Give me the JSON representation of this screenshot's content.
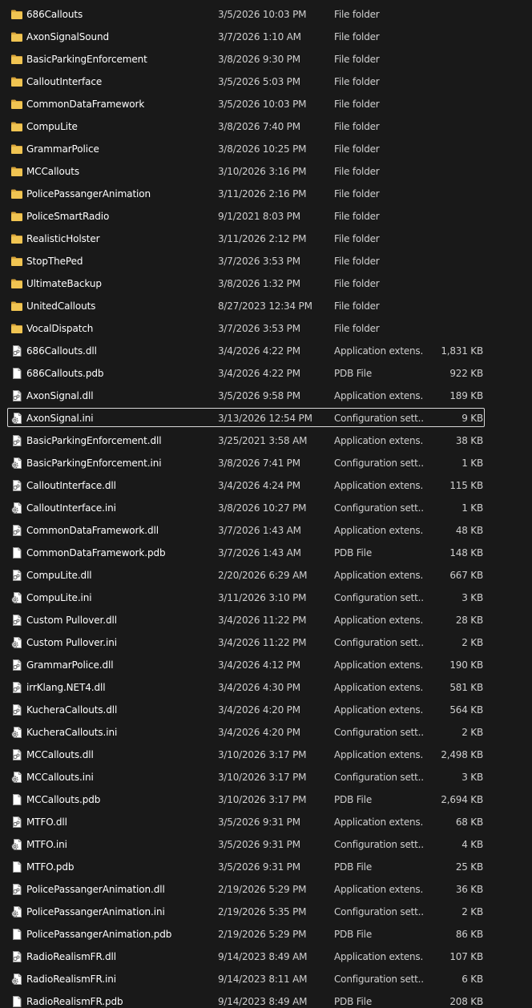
{
  "files": [
    {
      "name": "686Callouts",
      "date": "3/5/2026 10:03 PM",
      "type": "File folder",
      "size": "",
      "icon": "folder-icon"
    },
    {
      "name": "AxonSignalSound",
      "date": "3/7/2026 1:10 AM",
      "type": "File folder",
      "size": "",
      "icon": "folder-icon"
    },
    {
      "name": "BasicParkingEnforcement",
      "date": "3/8/2026 9:30 PM",
      "type": "File folder",
      "size": "",
      "icon": "folder-icon"
    },
    {
      "name": "CalloutInterface",
      "date": "3/5/2026 5:03 PM",
      "type": "File folder",
      "size": "",
      "icon": "folder-icon"
    },
    {
      "name": "CommonDataFramework",
      "date": "3/5/2026 10:03 PM",
      "type": "File folder",
      "size": "",
      "icon": "folder-icon"
    },
    {
      "name": "CompuLite",
      "date": "3/8/2026 7:40 PM",
      "type": "File folder",
      "size": "",
      "icon": "folder-icon"
    },
    {
      "name": "GrammarPolice",
      "date": "3/8/2026 10:25 PM",
      "type": "File folder",
      "size": "",
      "icon": "folder-icon"
    },
    {
      "name": "MCCallouts",
      "date": "3/10/2026 3:16 PM",
      "type": "File folder",
      "size": "",
      "icon": "folder-icon"
    },
    {
      "name": "PolicePassangerAnimation",
      "date": "3/11/2026 2:16 PM",
      "type": "File folder",
      "size": "",
      "icon": "folder-icon"
    },
    {
      "name": "PoliceSmartRadio",
      "date": "9/1/2021 8:03 PM",
      "type": "File folder",
      "size": "",
      "icon": "folder-icon"
    },
    {
      "name": "RealisticHolster",
      "date": "3/11/2026 2:12 PM",
      "type": "File folder",
      "size": "",
      "icon": "folder-icon"
    },
    {
      "name": "StopThePed",
      "date": "3/7/2026 3:53 PM",
      "type": "File folder",
      "size": "",
      "icon": "folder-icon"
    },
    {
      "name": "UltimateBackup",
      "date": "3/8/2026 1:32 PM",
      "type": "File folder",
      "size": "",
      "icon": "folder-icon"
    },
    {
      "name": "UnitedCallouts",
      "date": "8/27/2023 12:34 PM",
      "type": "File folder",
      "size": "",
      "icon": "folder-icon"
    },
    {
      "name": "VocalDispatch",
      "date": "3/7/2026 3:53 PM",
      "type": "File folder",
      "size": "",
      "icon": "folder-icon"
    },
    {
      "name": "686Callouts.dll",
      "date": "3/4/2026 4:22 PM",
      "type": "Application extens...",
      "size": "1,831 KB",
      "icon": "dll-file-icon"
    },
    {
      "name": "686Callouts.pdb",
      "date": "3/4/2026 4:22 PM",
      "type": "PDB File",
      "size": "922 KB",
      "icon": "blank-file-icon"
    },
    {
      "name": "AxonSignal.dll",
      "date": "3/5/2026 9:58 PM",
      "type": "Application extens...",
      "size": "189 KB",
      "icon": "dll-file-icon"
    },
    {
      "name": "AxonSignal.ini",
      "date": "3/13/2026 12:54 PM",
      "type": "Configuration sett...",
      "size": "9 KB",
      "icon": "config-file-icon",
      "selected": true
    },
    {
      "name": "BasicParkingEnforcement.dll",
      "date": "3/25/2021 3:58 AM",
      "type": "Application extens...",
      "size": "38 KB",
      "icon": "dll-file-icon"
    },
    {
      "name": "BasicParkingEnforcement.ini",
      "date": "3/8/2026 7:41 PM",
      "type": "Configuration sett...",
      "size": "1 KB",
      "icon": "config-file-icon"
    },
    {
      "name": "CalloutInterface.dll",
      "date": "3/4/2026 4:24 PM",
      "type": "Application extens...",
      "size": "115 KB",
      "icon": "dll-file-icon"
    },
    {
      "name": "CalloutInterface.ini",
      "date": "3/8/2026 10:27 PM",
      "type": "Configuration sett...",
      "size": "1 KB",
      "icon": "config-file-icon"
    },
    {
      "name": "CommonDataFramework.dll",
      "date": "3/7/2026 1:43 AM",
      "type": "Application extens...",
      "size": "48 KB",
      "icon": "dll-file-icon"
    },
    {
      "name": "CommonDataFramework.pdb",
      "date": "3/7/2026 1:43 AM",
      "type": "PDB File",
      "size": "148 KB",
      "icon": "blank-file-icon"
    },
    {
      "name": "CompuLite.dll",
      "date": "2/20/2026 6:29 AM",
      "type": "Application extens...",
      "size": "667 KB",
      "icon": "dll-file-icon"
    },
    {
      "name": "CompuLite.ini",
      "date": "3/11/2026 3:10 PM",
      "type": "Configuration sett...",
      "size": "3 KB",
      "icon": "config-file-icon"
    },
    {
      "name": "Custom Pullover.dll",
      "date": "3/4/2026 11:22 PM",
      "type": "Application extens...",
      "size": "28 KB",
      "icon": "dll-file-icon"
    },
    {
      "name": "Custom Pullover.ini",
      "date": "3/4/2026 11:22 PM",
      "type": "Configuration sett...",
      "size": "2 KB",
      "icon": "config-file-icon"
    },
    {
      "name": "GrammarPolice.dll",
      "date": "3/4/2026 4:12 PM",
      "type": "Application extens...",
      "size": "190 KB",
      "icon": "dll-file-icon"
    },
    {
      "name": "irrKlang.NET4.dll",
      "date": "3/4/2026 4:30 PM",
      "type": "Application extens...",
      "size": "581 KB",
      "icon": "dll-file-icon"
    },
    {
      "name": "KucheraCallouts.dll",
      "date": "3/4/2026 4:20 PM",
      "type": "Application extens...",
      "size": "564 KB",
      "icon": "dll-file-icon"
    },
    {
      "name": "KucheraCallouts.ini",
      "date": "3/4/2026 4:20 PM",
      "type": "Configuration sett...",
      "size": "2 KB",
      "icon": "config-file-icon"
    },
    {
      "name": "MCCallouts.dll",
      "date": "3/10/2026 3:17 PM",
      "type": "Application extens...",
      "size": "2,498 KB",
      "icon": "dll-file-icon"
    },
    {
      "name": "MCCallouts.ini",
      "date": "3/10/2026 3:17 PM",
      "type": "Configuration sett...",
      "size": "3 KB",
      "icon": "config-file-icon"
    },
    {
      "name": "MCCallouts.pdb",
      "date": "3/10/2026 3:17 PM",
      "type": "PDB File",
      "size": "2,694 KB",
      "icon": "blank-file-icon"
    },
    {
      "name": "MTFO.dll",
      "date": "3/5/2026 9:31 PM",
      "type": "Application extens...",
      "size": "68 KB",
      "icon": "dll-file-icon"
    },
    {
      "name": "MTFO.ini",
      "date": "3/5/2026 9:31 PM",
      "type": "Configuration sett...",
      "size": "4 KB",
      "icon": "config-file-icon"
    },
    {
      "name": "MTFO.pdb",
      "date": "3/5/2026 9:31 PM",
      "type": "PDB File",
      "size": "25 KB",
      "icon": "blank-file-icon"
    },
    {
      "name": "PolicePassangerAnimation.dll",
      "date": "2/19/2026 5:29 PM",
      "type": "Application extens...",
      "size": "36 KB",
      "icon": "dll-file-icon"
    },
    {
      "name": "PolicePassangerAnimation.ini",
      "date": "2/19/2026 5:35 PM",
      "type": "Configuration sett...",
      "size": "2 KB",
      "icon": "config-file-icon"
    },
    {
      "name": "PolicePassangerAnimation.pdb",
      "date": "2/19/2026 5:29 PM",
      "type": "PDB File",
      "size": "86 KB",
      "icon": "blank-file-icon"
    },
    {
      "name": "RadioRealismFR.dll",
      "date": "9/14/2023 8:49 AM",
      "type": "Application extens...",
      "size": "107 KB",
      "icon": "dll-file-icon"
    },
    {
      "name": "RadioRealismFR.ini",
      "date": "9/14/2023 8:11 AM",
      "type": "Configuration sett...",
      "size": "6 KB",
      "icon": "config-file-icon"
    },
    {
      "name": "RadioRealismFR.pdb",
      "date": "9/14/2023 8:49 AM",
      "type": "PDB File",
      "size": "208 KB",
      "icon": "blank-file-icon"
    }
  ],
  "colors": {
    "background": "#191919",
    "folder": "#f0c452",
    "text_primary": "#ffffff",
    "text_secondary": "#cfcfcf"
  }
}
